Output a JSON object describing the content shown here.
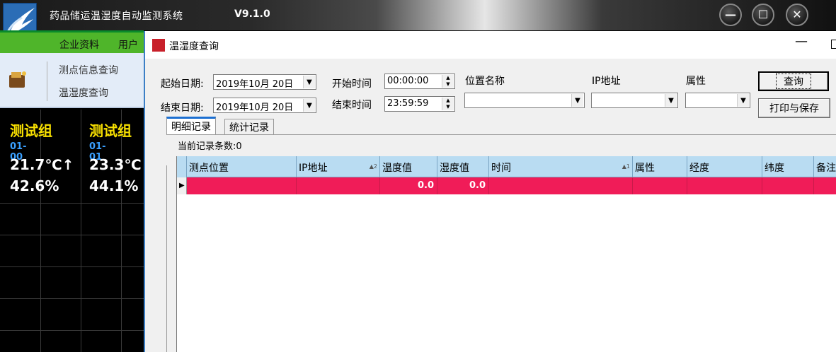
{
  "app": {
    "title": "药品储运温湿度自动监测系统",
    "version": "V9.1.0"
  },
  "window_buttons": {
    "minimize": "—",
    "maximize": "☐",
    "close": "✕"
  },
  "menu": {
    "items": [
      "企业资料",
      "用户"
    ]
  },
  "toolbar": {
    "items": [
      "测点信息查询",
      "温湿度查询"
    ]
  },
  "monitor": {
    "cells": [
      {
        "group": "测试组",
        "id": "01-00",
        "temperature": "21.7℃↑",
        "humidity": "42.6%"
      },
      {
        "group": "测试组",
        "id": "01-01",
        "temperature": "23.3℃",
        "humidity": "44.1%"
      }
    ]
  },
  "dialog": {
    "title": "温湿度查询",
    "start_date_label": "起始日期:",
    "start_date": "2019年10月 20日",
    "end_date_label": "结束日期:",
    "end_date": "2019年10月 20日",
    "start_time_label": "开始时间",
    "start_time": "00:00:00",
    "end_time_label": "结束时间",
    "end_time": "23:59:59",
    "location_label": "位置名称",
    "location_value": "",
    "ip_label": "IP地址",
    "ip_value": "",
    "attr_label": "属性",
    "attr_value": "",
    "query_button": "查询",
    "print_button": "打印与保存",
    "tabs": [
      "明细记录",
      "统计记录"
    ],
    "record_count": "当前记录条数:0",
    "grid": {
      "columns": [
        "测点位置",
        "IP地址",
        "温度值",
        "湿度值",
        "时间",
        "属性",
        "经度",
        "纬度",
        "备注"
      ],
      "sort_markers": {
        "ip": "▲2",
        "time": "▲1"
      },
      "rows": [
        {
          "location": "",
          "ip": "",
          "temperature": "0.0",
          "humidity": "0.0",
          "time": "",
          "attr": "",
          "longitude": "",
          "latitude": "",
          "note": ""
        }
      ]
    }
  }
}
